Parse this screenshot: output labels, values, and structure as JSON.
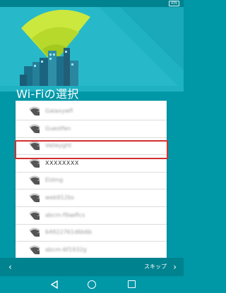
{
  "status_bar": {
    "battery_text": "43%"
  },
  "page": {
    "title": "Wi-Fiの選択"
  },
  "networks": [
    {
      "name": "Galaxywfl",
      "selected": false,
      "blurred": true
    },
    {
      "name": "Guestfen",
      "selected": false,
      "blurred": true
    },
    {
      "name": "Valleyght",
      "selected": false,
      "blurred": true
    },
    {
      "name": "XXXXXXXX",
      "selected": true,
      "blurred": false
    },
    {
      "name": "Eldmg",
      "selected": false,
      "blurred": true
    },
    {
      "name": "web912bs",
      "selected": false,
      "blurred": true
    },
    {
      "name": "abcm-f9aeflcs",
      "selected": false,
      "blurred": true
    },
    {
      "name": "64922761d6b6b",
      "selected": false,
      "blurred": true
    },
    {
      "name": "abcm-6f1932g",
      "selected": false,
      "blurred": true
    }
  ],
  "bottom_bar": {
    "back_icon": "chevron-left-icon",
    "skip_label": "スキップ",
    "skip_icon": "chevron-right-icon"
  },
  "nav_bar": {
    "back": "nav-back-icon",
    "home": "nav-home-icon",
    "recent": "nav-recent-icon"
  },
  "colors": {
    "accent": "#0097a7",
    "header": "#1fb2c3",
    "highlight": "#d32f2f",
    "cone": "#c6e83c"
  }
}
